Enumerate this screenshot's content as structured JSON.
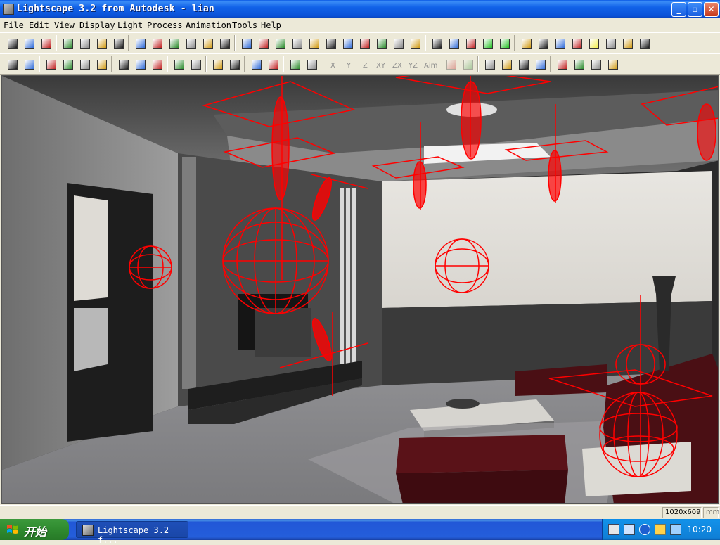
{
  "window": {
    "title": "Lightscape 3.2 from Autodesk - lian",
    "controls": [
      "minimize",
      "maximize",
      "close"
    ]
  },
  "menu": [
    "File",
    "Edit",
    "View",
    "Display",
    "Light",
    "Process",
    "Animation",
    "Tools",
    "Help"
  ],
  "toolbar1_icons": [
    "new-file-icon",
    "open-folder-icon",
    "save-icon",
    "undo-icon",
    "print-icon",
    "help-icon",
    "context-help-icon",
    "select-mode-icon",
    "view-front-icon",
    "view-back-icon",
    "view-left-icon",
    "view-right-icon",
    "view-top-icon",
    "zoom-region-icon",
    "orbit-icon",
    "pan-camera-icon",
    "zoom-in-icon",
    "zoom-out-icon",
    "move-icon",
    "walk-icon",
    "spin-icon",
    "rotate-icon",
    "zoom-window-icon",
    "zoom-all-icon",
    "wireframe-icon",
    "solid-icon",
    "outline-icon",
    "shaded-green-icon",
    "textured-green-icon",
    "layer-icon",
    "process-icon",
    "mesh-icon",
    "daylight-icon",
    "yellow-square-icon",
    "globe-icon",
    "grey-box-icon",
    "render-icon"
  ],
  "toolbar2_icons": [
    "select-arrow-icon",
    "query-icon",
    "select-surface-icon",
    "select-object-icon",
    "select-light-icon",
    "select-layer-icon",
    "cut-icon",
    "copy-icon",
    "align-icon",
    "select-cursor-icon",
    "shape-select-icon",
    "edit-list-icon",
    "filter-select-icon",
    "add-point-icon",
    "reset-view-icon",
    "move-axis-icon",
    "rotate-axis-icon"
  ],
  "axis_buttons": [
    "X",
    "Y",
    "Z",
    "XY",
    "ZX",
    "YZ",
    "Aim"
  ],
  "status": {
    "resolution": "1020x609",
    "unit": "mm"
  },
  "taskbar": {
    "start_label": "开始",
    "task_label": "Lightscape 3.2 f...",
    "clock": "10:20"
  },
  "colors": {
    "xp_blue": "#0A52D8",
    "chrome": "#ECE9D8",
    "light_wire": "#FF0000",
    "wall": "#8F8F8F",
    "sofa": "#5A1218"
  }
}
